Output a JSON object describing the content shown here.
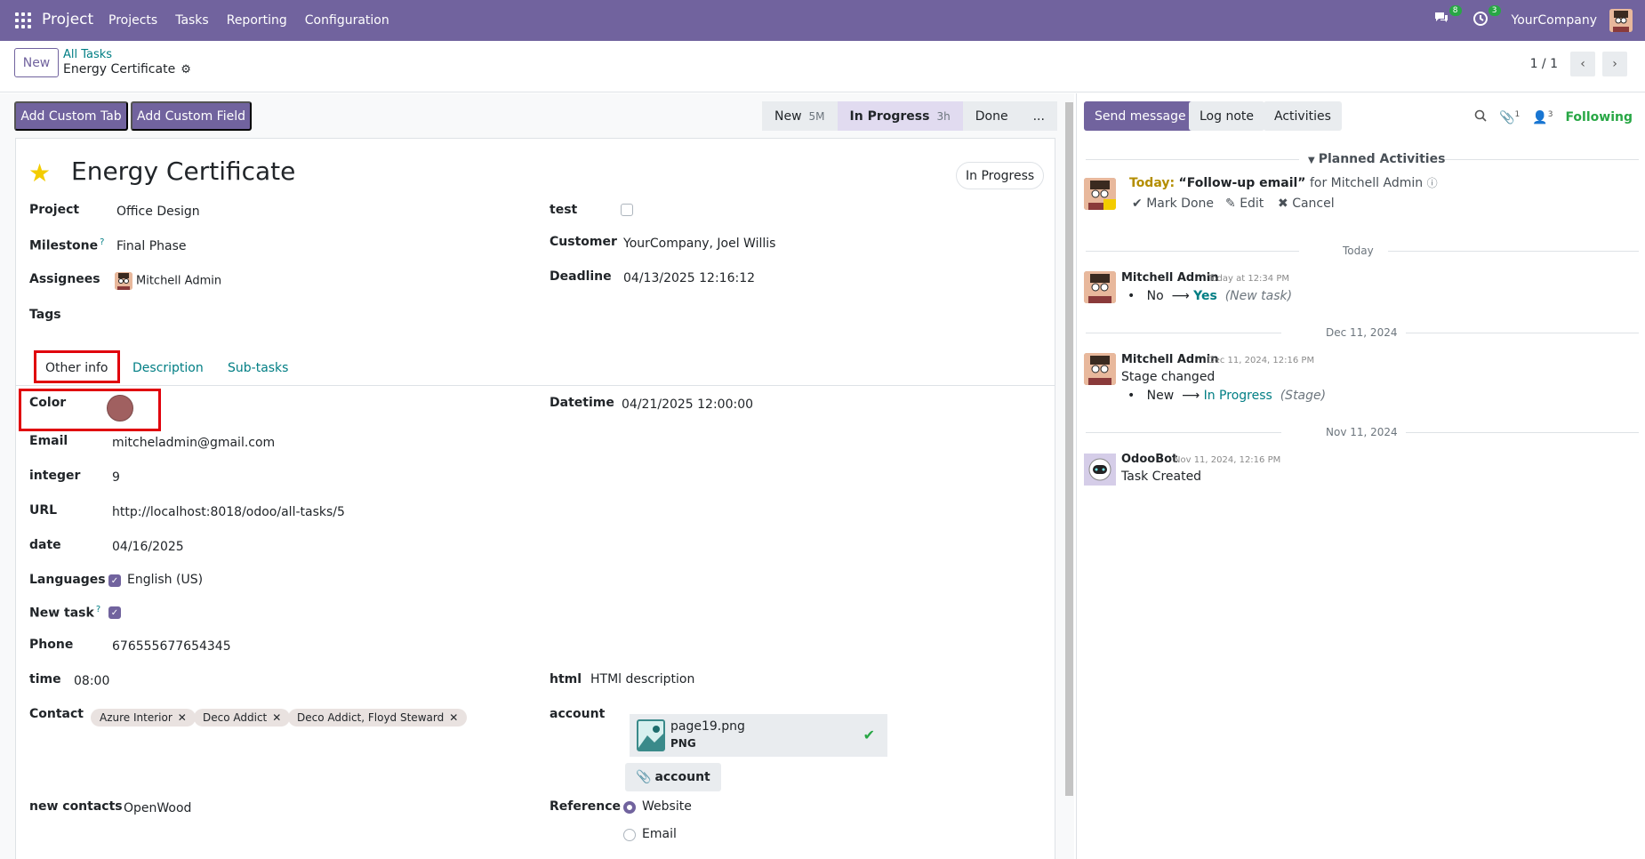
{
  "navbar": {
    "brand": "Project",
    "menu": [
      "Projects",
      "Tasks",
      "Reporting",
      "Configuration"
    ],
    "messages_count": "8",
    "activities_count": "3",
    "company": "YourCompany"
  },
  "control": {
    "new_label": "New",
    "breadcrumb_parent": "All Tasks",
    "breadcrumb_current": "Energy Certificate",
    "pager": "1 / 1"
  },
  "toolbar": {
    "add_custom_tab": "Add Custom Tab",
    "add_custom_field": "Add Custom Field"
  },
  "statusbar": {
    "stages": [
      {
        "label": "New",
        "duration": "5M"
      },
      {
        "label": "In Progress",
        "duration": "3h"
      },
      {
        "label": "Done",
        "duration": ""
      },
      {
        "label": "...",
        "duration": ""
      }
    ],
    "active_stage": "In Progress"
  },
  "task": {
    "title": "Energy Certificate",
    "status_pill": "In Progress",
    "fields": {
      "project_label": "Project",
      "project": "Office Design",
      "milestone_label": "Milestone",
      "milestone": "Final Phase",
      "assignees_label": "Assignees",
      "assignee": "Mitchell Admin",
      "tags_label": "Tags",
      "test_label": "test",
      "customer_label": "Customer",
      "customer": "YourCompany, Joel Willis",
      "deadline_label": "Deadline",
      "deadline": "04/13/2025 12:16:12"
    },
    "help_marker": "?"
  },
  "tabs": [
    "Other info",
    "Description",
    "Sub-tasks"
  ],
  "other_info": {
    "color_label": "Color",
    "color_value": "#a06060",
    "datetime_label": "Datetime",
    "datetime": "04/21/2025 12:00:00",
    "email_label": "Email",
    "email": "mitcheladmin@gmail.com",
    "integer_label": "integer",
    "integer": "9",
    "url_label": "URL",
    "url": "http://localhost:8018/odoo/all-tasks/5",
    "date_label": "date",
    "date": "04/16/2025",
    "languages_label": "Languages",
    "language": "English (US)",
    "new_task_label": "New task",
    "phone_label": "Phone",
    "phone": "676555677654345",
    "time_label": "time",
    "time": "08:00",
    "html_label": "html",
    "html": "HTMl description",
    "contact_label": "Contact",
    "contacts": [
      "Azure Interior",
      "Deco Addict",
      "Deco Addict, Floyd Steward"
    ],
    "account_label": "account",
    "attachment_name": "page19.png",
    "attachment_type": "PNG",
    "account_button": "account",
    "new_contacts_label": "new contacts",
    "new_contacts": "OpenWood",
    "reference_label": "Reference",
    "reference_options": [
      "Website",
      "Email"
    ],
    "reference_selected": "Website"
  },
  "chatter": {
    "send_message": "Send message",
    "log_note": "Log note",
    "activities": "Activities",
    "attachments_count": "1",
    "followers_count": "3",
    "following": "Following",
    "planned_activities": "Planned Activities",
    "activity": {
      "when": "Today:",
      "summary": "“Follow-up email”",
      "for": "for Mitchell Admin",
      "mark_done": "Mark Done",
      "edit": "Edit",
      "cancel": "Cancel"
    },
    "messages": [
      {
        "date_sep": "Today",
        "author": "Mitchell Admin",
        "meta": "Today at 12:34 PM",
        "old": "No",
        "new": "Yes",
        "field": "(New task)"
      },
      {
        "date_sep": "Dec 11, 2024",
        "author": "Mitchell Admin",
        "meta": "Dec 11, 2024, 12:16 PM",
        "text": "Stage changed",
        "old": "New",
        "new": "In Progress",
        "field": "(Stage)"
      },
      {
        "date_sep": "Nov 11, 2024",
        "author": "OdooBot",
        "meta": "Nov 11, 2024, 12:16 PM",
        "text": "Task Created"
      }
    ],
    "arrow": "⟶",
    "bullet": "•"
  }
}
